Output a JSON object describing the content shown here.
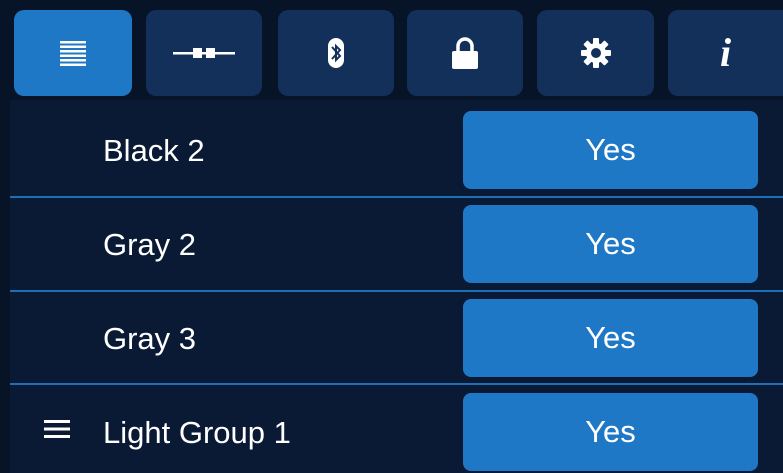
{
  "tabs": [
    {
      "icon": "list-icon",
      "active": true
    },
    {
      "icon": "connector-icon",
      "active": false
    },
    {
      "icon": "bluetooth-icon",
      "active": false
    },
    {
      "icon": "lock-icon",
      "active": false
    },
    {
      "icon": "gear-icon",
      "active": false
    },
    {
      "icon": "info-icon",
      "active": false,
      "glyph": "i"
    }
  ],
  "rows": [
    {
      "label": "Black 2",
      "value": "Yes"
    },
    {
      "label": "Gray 2",
      "value": "Yes"
    },
    {
      "label": "Gray 3",
      "value": "Yes"
    },
    {
      "label": "Light Group 1",
      "value": "Yes",
      "icon": "group-menu-icon"
    }
  ],
  "colors": {
    "background": "#0a1a34",
    "tab": "#13305a",
    "accent": "#1e78c6",
    "divider": "#1f6fb8"
  }
}
